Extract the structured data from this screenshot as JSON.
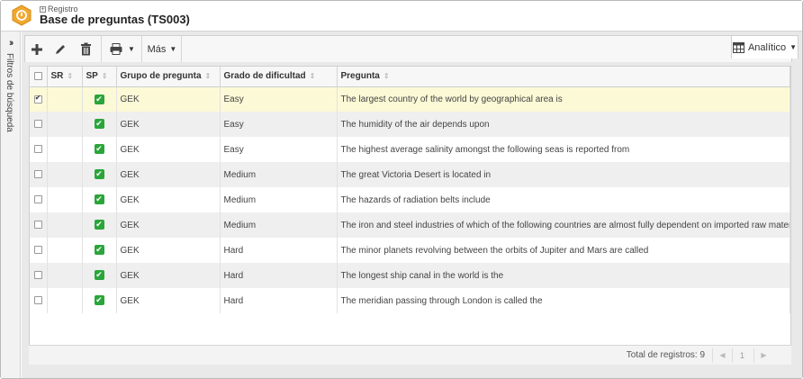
{
  "header": {
    "breadcrumb": "Registro",
    "title": "Base de preguntas (TS003)"
  },
  "sidebar": {
    "label": "Filtros de búsqueda"
  },
  "toolbar": {
    "more_label": "Más",
    "view_label": "Analítico"
  },
  "table": {
    "columns": [
      "SR",
      "SP",
      "Grupo de pregunta",
      "Grado de dificultad",
      "Pregunta"
    ],
    "rows": [
      {
        "group": "GEK",
        "difficulty": "Easy",
        "question": "The largest country of the world by geographical area is",
        "selected": true
      },
      {
        "group": "GEK",
        "difficulty": "Easy",
        "question": "The humidity of the air depends upon",
        "selected": false
      },
      {
        "group": "GEK",
        "difficulty": "Easy",
        "question": "The highest average salinity amongst the following seas is reported from",
        "selected": false
      },
      {
        "group": "GEK",
        "difficulty": "Medium",
        "question": "The great Victoria Desert is located in",
        "selected": false
      },
      {
        "group": "GEK",
        "difficulty": "Medium",
        "question": "The hazards of radiation belts include",
        "selected": false
      },
      {
        "group": "GEK",
        "difficulty": "Medium",
        "question": "The iron and steel industries of which of the following countries are almost fully dependent on imported raw materials?",
        "selected": false
      },
      {
        "group": "GEK",
        "difficulty": "Hard",
        "question": "The minor planets revolving between the orbits of Jupiter and Mars are called",
        "selected": false
      },
      {
        "group": "GEK",
        "difficulty": "Hard",
        "question": "The longest ship canal in the world is the",
        "selected": false
      },
      {
        "group": "GEK",
        "difficulty": "Hard",
        "question": "The meridian passing through London is called the",
        "selected": false
      }
    ]
  },
  "footer": {
    "total": "Total de registros: 9",
    "page": "1"
  },
  "colors": {
    "accent": "#f0a830",
    "green": "#2aa53a",
    "selected_row": "#fcf9d6"
  }
}
